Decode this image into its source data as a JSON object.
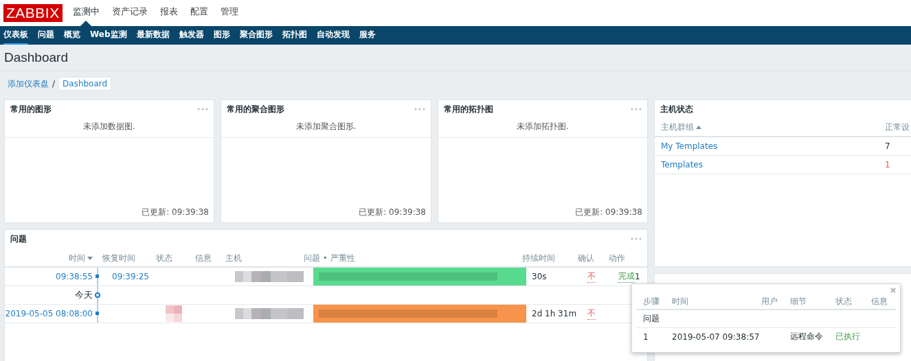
{
  "logo": "ZABBIX",
  "top_menu": [
    {
      "label": "监测中",
      "selected": true
    },
    {
      "label": "资产记录",
      "selected": false
    },
    {
      "label": "报表",
      "selected": false
    },
    {
      "label": "配置",
      "selected": false
    },
    {
      "label": "管理",
      "selected": false
    }
  ],
  "sub_menu": [
    {
      "label": "仪表板",
      "selected": true
    },
    {
      "label": "问题",
      "selected": false
    },
    {
      "label": "概览",
      "selected": false
    },
    {
      "label": "Web监测",
      "selected": false
    },
    {
      "label": "最新数据",
      "selected": false
    },
    {
      "label": "触发器",
      "selected": false
    },
    {
      "label": "图形",
      "selected": false
    },
    {
      "label": "聚合图形",
      "selected": false
    },
    {
      "label": "拓扑图",
      "selected": false
    },
    {
      "label": "自动发现",
      "selected": false
    },
    {
      "label": "服务",
      "selected": false
    }
  ],
  "page_title": "Dashboard",
  "breadcrumb": [
    {
      "label": "添加仪表盘",
      "selected": false
    },
    {
      "label": "Dashboard",
      "selected": true
    }
  ],
  "separator": "/",
  "widgets": [
    {
      "title": "常用的图形",
      "empty_text": "未添加数据图.",
      "updated": "已更新: 09:39:38"
    },
    {
      "title": "常用的聚合图形",
      "empty_text": "未添加聚合图形.",
      "updated": "已更新: 09:39:38"
    },
    {
      "title": "常用的拓扑图",
      "empty_text": "未添加拓扑图.",
      "updated": "已更新: 09:39:38"
    }
  ],
  "host_status": {
    "title": "主机状态",
    "columns": [
      {
        "label": "主机群组",
        "sorted": true
      },
      {
        "label": "正常设",
        "sorted": false
      }
    ],
    "rows": [
      {
        "group": "My Templates",
        "count": "7",
        "color": "#1f2c33"
      },
      {
        "group": "Templates",
        "count": "1",
        "color": "#e45959"
      }
    ]
  },
  "problems": {
    "title": "问题",
    "columns": [
      "时间",
      "恢复时间",
      "状态",
      "信息",
      "主机",
      "问题 • 严重性",
      "持续时间",
      "确认",
      "动作"
    ],
    "rows": [
      {
        "kind": "event",
        "time": "09:38:55",
        "recovery": "09:39:25",
        "color": "#59db8f",
        "duration": "30s",
        "ack": "不",
        "action": "完成",
        "action_count": "1"
      },
      {
        "kind": "divider",
        "label": "今天"
      },
      {
        "kind": "event",
        "time": "2019-05-05 08:08:00",
        "color": "#f7934b",
        "duration": "2d 1h 31m",
        "ack": "不"
      }
    ]
  },
  "popup": {
    "columns": [
      "步骤",
      "时间",
      "用户",
      "细节",
      "状态",
      "信息"
    ],
    "section": "问题",
    "rows": [
      {
        "step": "1",
        "time": "2019-05-07 09:38:57",
        "detail": "远程命令",
        "status": "已执行"
      }
    ]
  }
}
